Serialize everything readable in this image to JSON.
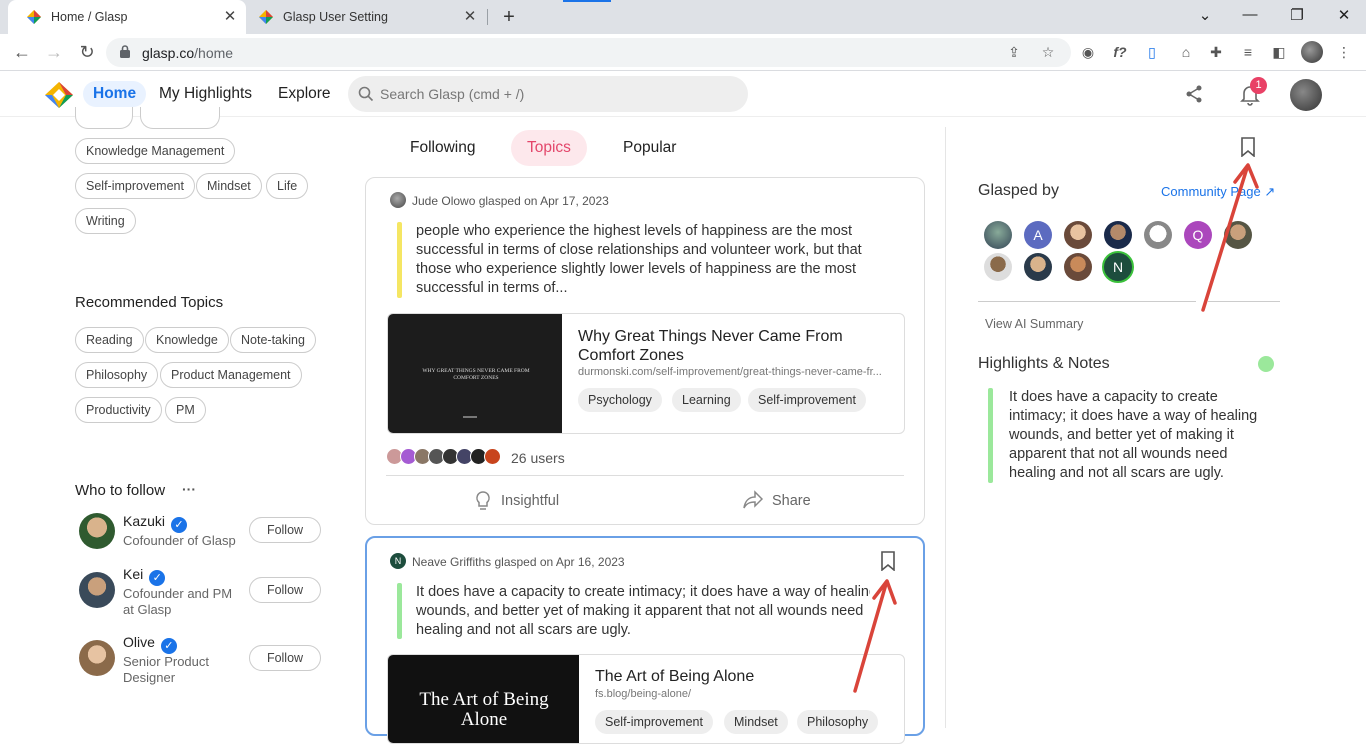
{
  "browser": {
    "tabs": [
      {
        "title": "Home / Glasp",
        "active": true
      },
      {
        "title": "Glasp User Setting",
        "active": false
      }
    ],
    "url_host": "glasp.co",
    "url_path": "/home"
  },
  "header": {
    "nav": [
      "Home",
      "My Highlights",
      "Explore"
    ],
    "search_placeholder": "Search Glasp (cmd + /)",
    "notification_count": "1"
  },
  "sidebar": {
    "my_topics": [
      "Knowledge Management",
      "Self-improvement",
      "Mindset",
      "Life",
      "Writing"
    ],
    "recommended_title": "Recommended Topics",
    "recommended_topics": [
      "Reading",
      "Knowledge",
      "Note-taking",
      "Philosophy",
      "Product Management",
      "Productivity",
      "PM"
    ],
    "who_title": "Who to follow",
    "more_label": "···",
    "who_to_follow": [
      {
        "name": "Kazuki",
        "role": "Cofounder of Glasp",
        "follow": "Follow"
      },
      {
        "name": "Kei",
        "role": "Cofounder and PM at Glasp",
        "follow": "Follow"
      },
      {
        "name": "Olive",
        "role": "Senior Product Designer",
        "follow": "Follow"
      }
    ]
  },
  "feed": {
    "tabs": [
      "Following",
      "Topics",
      "Popular"
    ],
    "active_tab": "Topics",
    "posts": [
      {
        "meta": "Jude Olowo glasped on Apr 17, 2023",
        "quote": "people who experience the highest levels of happiness are the most successful in terms of close relationships and volunteer work, but that those who experience slightly lower levels of happiness are the most successful in terms of...",
        "highlight_color": "#f5e663",
        "link_title": "Why Great Things Never Came From Comfort Zones",
        "link_url": "durmonski.com/self-improvement/great-things-never-came-fr...",
        "thumb_text": "WHY GREAT THINGS NEVER CAME FROM COMFORT ZONES",
        "tags": [
          "Psychology",
          "Learning",
          "Self-improvement"
        ],
        "users": "26 users",
        "insightful": "Insightful",
        "share": "Share"
      },
      {
        "meta": "Neave Griffiths glasped on Apr 16, 2023",
        "author_initial": "N",
        "quote": "It does have a capacity to create intimacy; it does have a way of healing wounds, and better yet of making it apparent that not all wounds need healing and not all scars are ugly.",
        "highlight_color": "#9be89b",
        "link_title": "The Art of Being Alone",
        "link_url": "fs.blog/being-alone/",
        "thumb_text": "The Art of Being Alone",
        "tags": [
          "Self-improvement",
          "Mindset",
          "Philosophy"
        ]
      }
    ]
  },
  "right_panel": {
    "glasped_by_title": "Glasped by",
    "community_link": "Community Page ↗",
    "glasped_by_initials": [
      "A",
      "Q",
      "N"
    ],
    "ai_summary": "View AI Summary",
    "highlights_title": "Highlights & Notes",
    "highlight_text": "It does have a capacity to create intimacy; it does have a way of healing wounds, and better yet of making it apparent that not all wounds need healing and not all scars are ugly.",
    "highlight_color": "#9be89b"
  },
  "colors": {
    "accent_blue": "#1a73e8",
    "topics_pink": "#e3476b",
    "annotation_red": "#d9443a"
  }
}
